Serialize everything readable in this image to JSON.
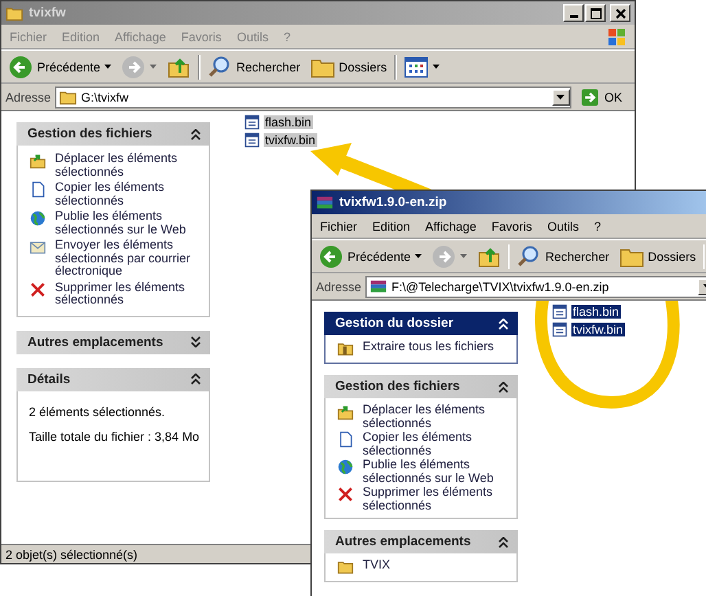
{
  "windows": [
    {
      "kind": "folder",
      "title": "tvixfw",
      "active": false,
      "menu": [
        "Fichier",
        "Edition",
        "Affichage",
        "Favoris",
        "Outils",
        "?"
      ],
      "toolbar": {
        "back": "Précédente",
        "search": "Rechercher",
        "folders": "Dossiers"
      },
      "address": {
        "label": "Adresse",
        "value": "G:\\tvixfw",
        "go": "OK"
      },
      "panels": [
        {
          "kind": "tasks",
          "title": "Gestion des fichiers",
          "expanded": true,
          "items": [
            {
              "kind": "move",
              "label": "Déplacer les éléments sélectionnés"
            },
            {
              "kind": "copy",
              "label": "Copier les éléments sélectionnés"
            },
            {
              "kind": "web",
              "label": "Publie les éléments sélectionnés sur le Web"
            },
            {
              "kind": "mail",
              "label": "Envoyer les éléments sélectionnés par courrier électronique"
            },
            {
              "kind": "delete",
              "label": "Supprimer les éléments sélectionnés"
            }
          ]
        },
        {
          "kind": "tasks",
          "title": "Autres emplacements",
          "expanded": false
        },
        {
          "kind": "details",
          "title": "Détails",
          "expanded": true,
          "lines": [
            "2 éléments sélectionnés.",
            "Taille totale du fichier : 3,84 Mo"
          ]
        }
      ],
      "files": [
        {
          "name": "flash.bin",
          "selected": true
        },
        {
          "name": "tvixfw.bin",
          "selected": true
        }
      ],
      "status_bar": "2 objet(s) sélectionné(s)"
    },
    {
      "kind": "archive",
      "title": "tvixfw1.9.0-en.zip",
      "active": true,
      "menu": [
        "Fichier",
        "Edition",
        "Affichage",
        "Favoris",
        "Outils",
        "?"
      ],
      "toolbar": {
        "back": "Précédente",
        "search": "Rechercher",
        "folders": "Dossiers"
      },
      "address": {
        "label": "Adresse",
        "value": "F:\\@Telecharge\\TVIX\\tvixfw1.9.0-en.zip"
      },
      "panels": [
        {
          "kind": "special",
          "title": "Gestion du dossier",
          "expanded": true,
          "items": [
            {
              "kind": "extract",
              "label": "Extraire tous les fichiers"
            }
          ]
        },
        {
          "kind": "tasks",
          "title": "Gestion des fichiers",
          "expanded": true,
          "items": [
            {
              "kind": "move",
              "label": "Déplacer les éléments sélectionnés"
            },
            {
              "kind": "copy",
              "label": "Copier les éléments sélectionnés"
            },
            {
              "kind": "web",
              "label": "Publie les éléments sélectionnés sur le Web"
            },
            {
              "kind": "delete",
              "label": "Supprimer les éléments sélectionnés"
            }
          ]
        },
        {
          "kind": "tasks",
          "title": "Autres emplacements",
          "expanded": true,
          "items": [
            {
              "kind": "folder",
              "label": "TVIX"
            }
          ]
        }
      ],
      "files": [
        {
          "name": "flash.bin",
          "selected": true
        },
        {
          "name": "tvixfw.bin",
          "selected": true
        }
      ]
    }
  ]
}
